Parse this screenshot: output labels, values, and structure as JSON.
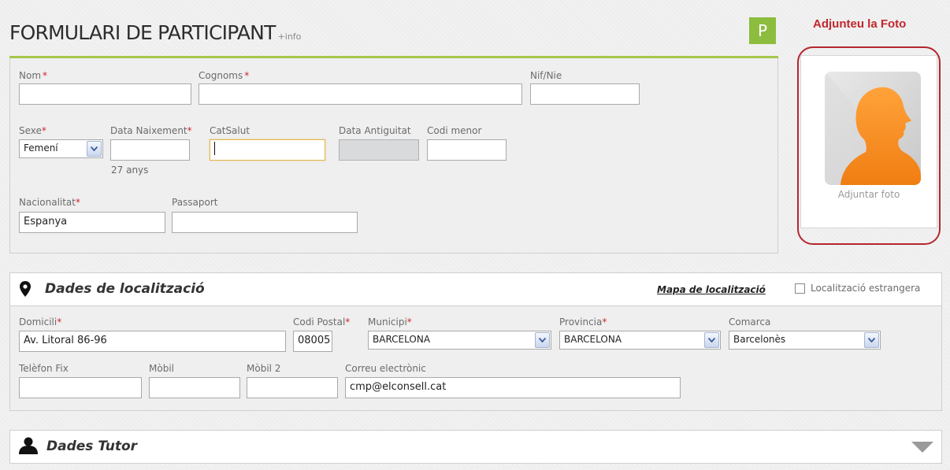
{
  "form": {
    "title": "FORMULARI DE PARTICIPANT",
    "info_link": "+info",
    "badge": "P"
  },
  "photo": {
    "heading": "Adjunteu la Foto",
    "caption": "Adjuntar foto",
    "icon": "person-silhouette-icon"
  },
  "personal": {
    "nom_label": "Nom",
    "nom_value": "",
    "cognoms_label": "Cognoms",
    "cognoms_value": "",
    "nif_label": "Nif/Nie",
    "nif_value": "",
    "sexe_label": "Sexe",
    "sexe_value": "Femení",
    "naixement_label": "Data Naixement",
    "naixement_value": "",
    "age_text": "27 anys",
    "catsalut_label": "CatSalut",
    "catsalut_value": "",
    "antiguitat_label": "Data Antiguitat",
    "antiguitat_value": "",
    "codi_menor_label": "Codi menor",
    "codi_menor_value": "",
    "nacionalitat_label": "Nacionalitat",
    "nacionalitat_value": "Espanya",
    "passaport_label": "Passaport",
    "passaport_value": "",
    "required_mark": "*"
  },
  "localitzacio": {
    "title": "Dades de localització",
    "map_link": "Mapa de localització",
    "foreign_label": "Localització estrangera",
    "foreign_checked": false,
    "domicili_label": "Domicili",
    "domicili_value": "Av. Litoral 86-96",
    "cp_label": "Codi Postal",
    "cp_value": "08005",
    "municipi_label": "Municipi",
    "municipi_value": "BARCELONA",
    "provincia_label": "Provincia",
    "provincia_value": "BARCELONA",
    "comarca_label": "Comarca",
    "comarca_value": "Barcelonès",
    "tel_label": "Telèfon Fix",
    "tel_value": "",
    "mobil_label": "Mòbil",
    "mobil_value": "",
    "mobil2_label": "Mòbil 2",
    "mobil2_value": "",
    "email_label": "Correu electrònic",
    "email_value": "cmp@elconsell.cat"
  },
  "tutor": {
    "title": "Dades Tutor"
  },
  "colors": {
    "accent_green": "#8dbd3f",
    "required_red": "#d0262c",
    "photo_red": "#b3262e",
    "avatar_orange": "#f7941d"
  }
}
